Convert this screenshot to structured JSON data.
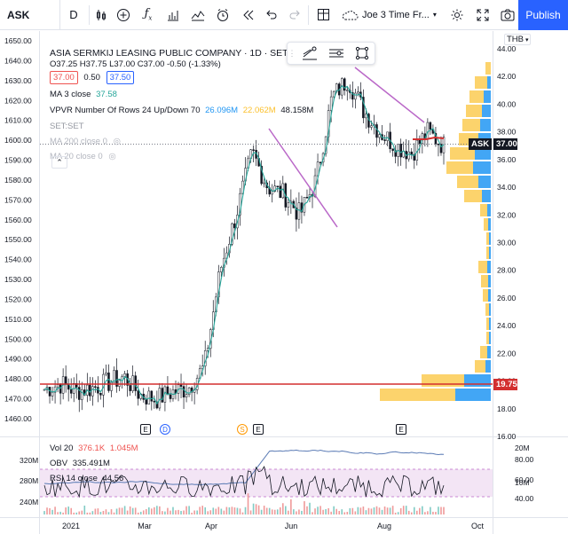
{
  "toolbar": {
    "symbol": "ASK",
    "interval": "D",
    "layout_name": "Joe 3 Time Fr...",
    "publish": "Publish",
    "icons": [
      "candles-icon",
      "plus-circle-icon",
      "fx-icon",
      "templates-icon",
      "compare-icon",
      "alert-icon",
      "replay-icon",
      "undo-icon",
      "redo-icon",
      "layout-icon",
      "cloud-icon",
      "gear-icon",
      "fullscreen-icon",
      "camera-icon"
    ]
  },
  "legend": {
    "title": "ASIA SERMKIJ LEASING PUBLIC COMPANY · 1D · SET",
    "ohlc": "O37.25 H37.75 L37.00 C37.00 -0.50 (-1.33%)",
    "bid": "37.00",
    "spread": "0.50",
    "ask": "37.50",
    "ma3_label": "MA 3 close",
    "ma3_value": "37.58",
    "vpvr_label": "VPVR Number Of Rows 24 Up/Down 70",
    "vpvr_up": "26.096M",
    "vpvr_down": "22.062M",
    "vpvr_total": "48.158M",
    "set_label": "SET:SET",
    "ma200_label": "MA 200 close 0",
    "ma20_label": "MA 20 close 0",
    "currency": "THB"
  },
  "price_tags": {
    "ask_label": "ASK",
    "ask_value": "37.00",
    "line_value": "19.75"
  },
  "lower": {
    "vol_label": "Vol 20",
    "vol_v1": "376.1K",
    "vol_v2": "1.045M",
    "obv_label": "OBV",
    "obv_value": "335.491M",
    "rsi_label": "RSI 14 close",
    "rsi_value": "44.56"
  },
  "events": [
    "E",
    "D",
    "S",
    "E",
    "E"
  ],
  "colors": {
    "up": "#26a69a",
    "down": "#ef5350",
    "ma": "#26a69a",
    "trend": "#ba68c8",
    "vp_up": "#2196f3",
    "vp_down": "#fbc02d",
    "rsi_band": "#e1bee7",
    "accent": "#2962ff"
  },
  "chart_data": {
    "type": "candlestick",
    "left_axis": {
      "ticks": [
        1650,
        1640,
        1630,
        1620,
        1610,
        1600,
        1590,
        1580,
        1570,
        1560,
        1550,
        1540,
        1530,
        1520,
        1510,
        1500,
        1490,
        1480,
        1470,
        1460
      ],
      "range": [
        1460,
        1652
      ]
    },
    "right_axis": {
      "ticks": [
        "44.00",
        "42.00",
        "40.00",
        "38.00",
        "36.00",
        "34.00",
        "32.00",
        "30.00",
        "28.00",
        "26.00",
        "24.00",
        "22.00",
        "20.00",
        "18.00",
        "16.00"
      ],
      "range": [
        16,
        44
      ]
    },
    "x_labels": [
      "2021",
      "Mar",
      "Apr",
      "Jun",
      "Aug",
      "Oct"
    ],
    "lower_left_ticks": [
      "320M",
      "280M",
      "240M"
    ],
    "lower_right_ticks": [
      "20M",
      "10M",
      "80.00",
      "60.00",
      "40.00"
    ],
    "last_close": 37.0,
    "price_path": [
      [
        "Jan",
        19.4
      ],
      [
        "Jan",
        19.8
      ],
      [
        "Jan",
        19.3
      ],
      [
        "Feb",
        19.5
      ],
      [
        "Feb",
        19.9
      ],
      [
        "Feb",
        20.3
      ],
      [
        "Mar",
        19.0
      ],
      [
        "Mar",
        18.7
      ],
      [
        "Mar",
        19.2
      ],
      [
        "Apr",
        19.5
      ],
      [
        "Apr",
        21.0
      ],
      [
        "Apr",
        28.0
      ],
      [
        "May",
        32.0
      ],
      [
        "May",
        36.5
      ],
      [
        "May",
        34.0
      ],
      [
        "Jun",
        33.5
      ],
      [
        "Jun",
        32.0
      ],
      [
        "Jun",
        34.5
      ],
      [
        "Jun",
        40.5
      ],
      [
        "Jul",
        41.8
      ],
      [
        "Jul",
        39.5
      ],
      [
        "Jul",
        38.0
      ],
      [
        "Aug",
        37.0
      ],
      [
        "Aug",
        36.5
      ],
      [
        "Aug",
        38.0
      ],
      [
        "Aug",
        37.0
      ]
    ]
  }
}
